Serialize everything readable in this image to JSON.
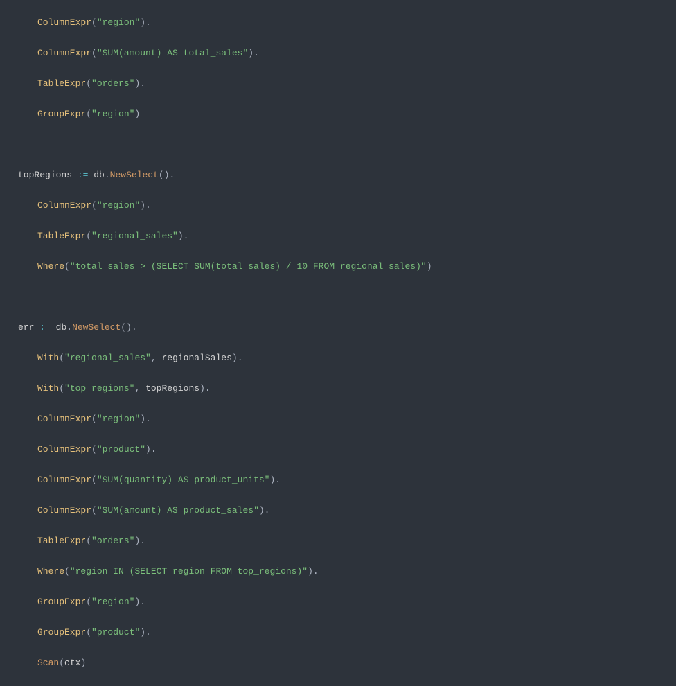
{
  "code": {
    "l1a": "ColumnExpr",
    "l1s": "\"region\"",
    "l2a": "ColumnExpr",
    "l2s": "\"SUM(amount) AS total_sales\"",
    "l3a": "TableExpr",
    "l3s": "\"orders\"",
    "l4a": "GroupExpr",
    "l4s": "\"region\"",
    "v1": "topRegions",
    "op": ":=",
    "db": "db",
    "ns": "NewSelect",
    "l5a": "ColumnExpr",
    "l5s": "\"region\"",
    "l6a": "TableExpr",
    "l6s": "\"regional_sales\"",
    "l7a": "Where",
    "l7s": "\"total_sales > (SELECT SUM(total_sales) / 10 FROM regional_sales)\"",
    "v2": "err",
    "l8a": "With",
    "l8s": "\"regional_sales\"",
    "l8v": "regionalSales",
    "l9a": "With",
    "l9s": "\"top_regions\"",
    "l9v": "topRegions",
    "l10a": "ColumnExpr",
    "l10s": "\"region\"",
    "l11a": "ColumnExpr",
    "l11s": "\"product\"",
    "l12a": "ColumnExpr",
    "l12s": "\"SUM(quantity) AS product_units\"",
    "l13a": "ColumnExpr",
    "l13s": "\"SUM(amount) AS product_sales\"",
    "l14a": "TableExpr",
    "l14s": "\"orders\"",
    "l15a": "Where",
    "l15s": "\"region IN (SELECT region FROM top_regions)\"",
    "l16a": "GroupExpr",
    "l16s": "\"region\"",
    "l17a": "GroupExpr",
    "l17s": "\"product\"",
    "l18a": "Scan",
    "l18v": "ctx"
  }
}
